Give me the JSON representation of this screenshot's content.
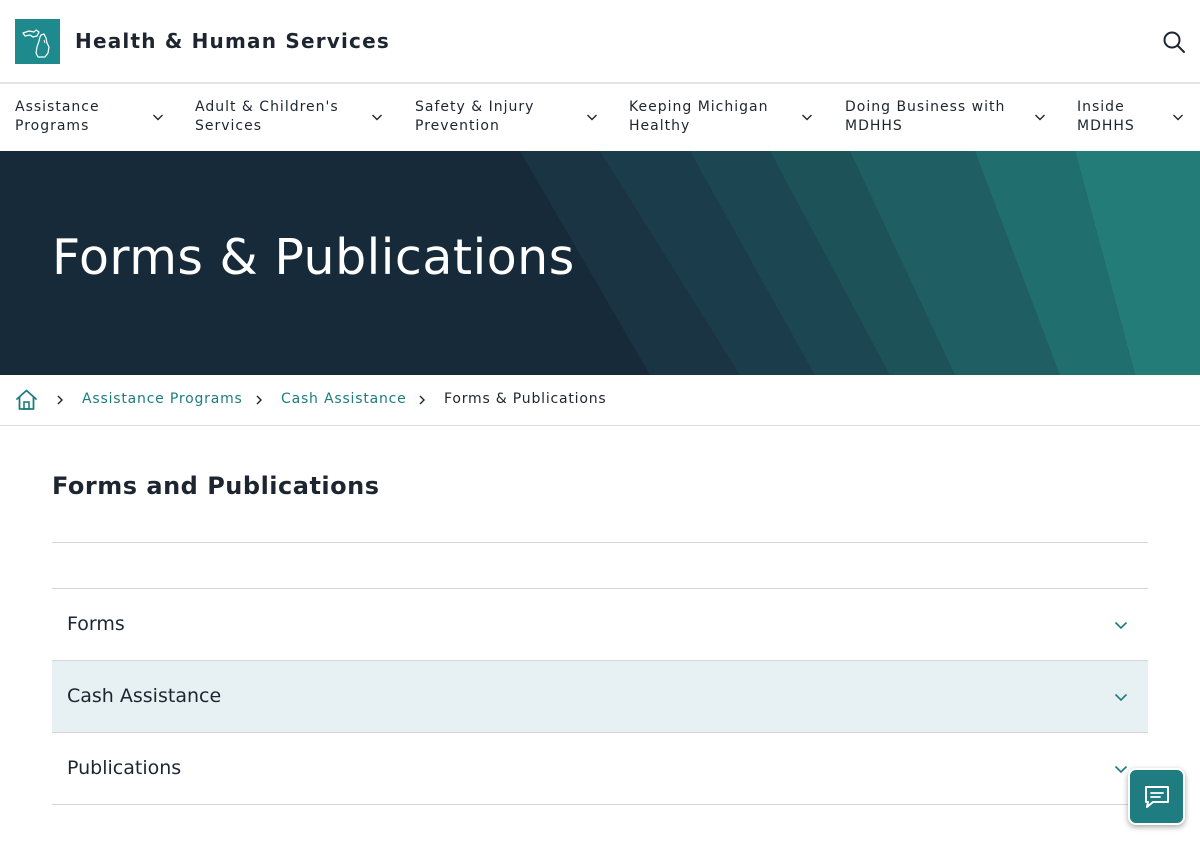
{
  "header": {
    "site_title": "Health & Human Services",
    "logo_icon": "michigan-state-icon",
    "search_icon": "search-icon"
  },
  "nav": {
    "items": [
      {
        "line1": "Assistance",
        "line2": "Programs"
      },
      {
        "line1": "Adult & Children's",
        "line2": "Services"
      },
      {
        "line1": "Safety & Injury",
        "line2": "Prevention"
      },
      {
        "line1": "Keeping Michigan",
        "line2": "Healthy"
      },
      {
        "line1": "Doing Business with",
        "line2": "MDHHS"
      },
      {
        "line1": "Inside",
        "line2": "MDHHS"
      }
    ]
  },
  "hero": {
    "title": "Forms & Publications"
  },
  "breadcrumb": {
    "home_icon": "home-icon",
    "items": [
      "Assistance Programs",
      "Cash Assistance"
    ],
    "current": "Forms & Publications"
  },
  "main": {
    "section_title": "Forms and Publications",
    "accordions": [
      {
        "label": "Forms",
        "expanded": false
      },
      {
        "label": "Cash Assistance",
        "expanded": false
      },
      {
        "label": "Publications",
        "expanded": false
      }
    ]
  },
  "chat": {
    "icon": "chat-icon"
  },
  "colors": {
    "accent": "#1f7c7c",
    "hero_bg": "#172a3a",
    "accordion_highlight": "#e7f1f3"
  }
}
